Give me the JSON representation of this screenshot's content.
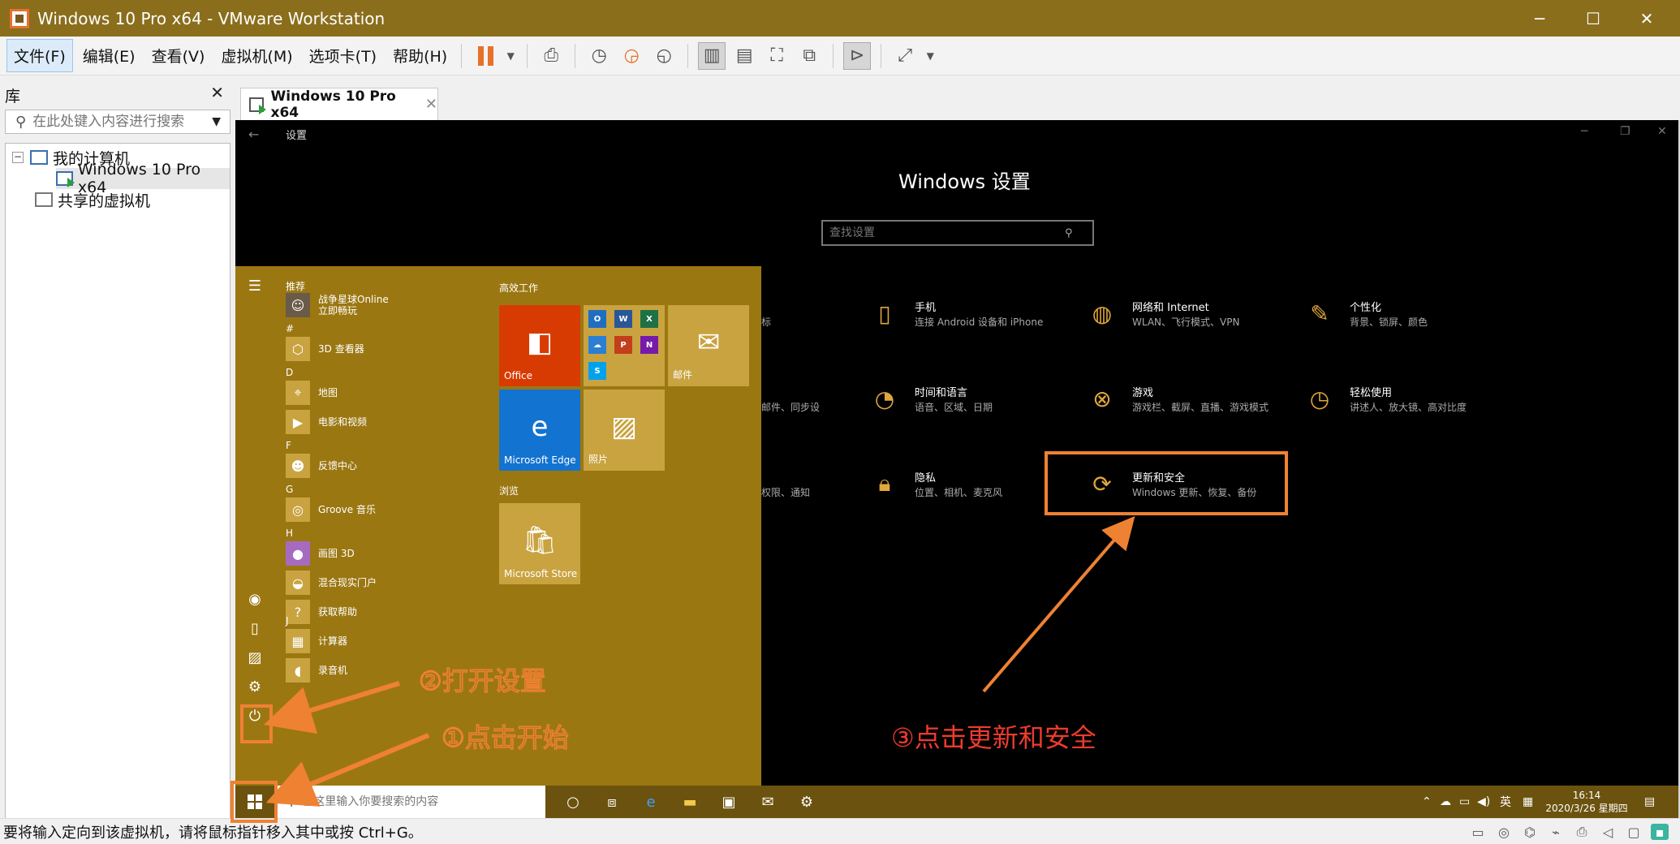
{
  "window": {
    "title": "Windows 10 Pro x64 - VMware Workstation",
    "controls": [
      "─",
      "☐",
      "✕"
    ]
  },
  "menu": [
    "文件(F)",
    "编辑(E)",
    "查看(V)",
    "虚拟机(M)",
    "选项卡(T)",
    "帮助(H)"
  ],
  "library": {
    "title": "库",
    "search_placeholder": "在此处键入内容进行搜索",
    "tree": {
      "my_computer": "我的计算机",
      "vm": "Windows 10 Pro x64",
      "shared": "共享的虚拟机"
    }
  },
  "vm_tab": {
    "label": "Windows 10 Pro x64"
  },
  "settings": {
    "window_title": "设置",
    "heading": "Windows 设置",
    "search_placeholder": "查找设置",
    "items": [
      {
        "name": "手机",
        "desc": "连接 Android 设备和 iPhone",
        "icon": "phone-icon"
      },
      {
        "name": "网络和 Internet",
        "desc": "WLAN、飞行模式、VPN",
        "icon": "globe-icon"
      },
      {
        "name": "个性化",
        "desc": "背景、锁屏、颜色",
        "icon": "personalize-icon"
      },
      {
        "name": "时间和语言",
        "desc": "语音、区域、日期",
        "icon": "time-language-icon"
      },
      {
        "name": "游戏",
        "desc": "游戏栏、截屏、直播、游戏模式",
        "icon": "xbox-icon"
      },
      {
        "name": "轻松使用",
        "desc": "讲述人、放大镜、高对比度",
        "icon": "ease-of-access-icon"
      },
      {
        "name": "隐私",
        "desc": "位置、相机、麦克风",
        "icon": "lock-icon"
      },
      {
        "name": "更新和安全",
        "desc": "Windows 更新、恢复、备份",
        "icon": "update-icon"
      }
    ],
    "fragments": [
      "标",
      "邮件、同步设",
      "权限、通知"
    ]
  },
  "start_menu": {
    "sections": {
      "recommended": "推荐",
      "hash": "#",
      "d": "D",
      "f": "F",
      "g": "G",
      "h": "H",
      "j": "J"
    },
    "apps": {
      "game_line1": "战争星球Online",
      "game_line2": "立即畅玩",
      "viewer3d": "3D 查看器",
      "maps": "地图",
      "movies": "电影和视频",
      "feedback": "反馈中心",
      "groove": "Groove 音乐",
      "paint3d": "画图 3D",
      "mixed_reality": "混合现实门户",
      "get_help": "获取帮助",
      "calculator": "计算器",
      "recorder": "录音机"
    },
    "tile_groups": {
      "productivity": "高效工作",
      "browse": "浏览"
    },
    "tiles": {
      "office": "Office",
      "mail": "邮件",
      "edge": "Microsoft Edge",
      "photos": "照片",
      "store": "Microsoft Store"
    }
  },
  "taskbar": {
    "search_placeholder": "在这里输入你要搜索的内容",
    "ime": "英",
    "time": "16:14",
    "date": "2020/3/26 星期四"
  },
  "status_bar": {
    "text": "要将输入定向到该虚拟机，请将鼠标指针移入其中或按 Ctrl+G。"
  },
  "annotations": {
    "step1": "①点击开始",
    "step2": "②打开设置",
    "step3": "③点击更新和安全"
  },
  "colors": {
    "title_bar": "#8a6e1c",
    "start_menu": "#9b7712",
    "taskbar": "#6b520e",
    "accent": "#e0a73a",
    "annotation_orange": "#ef8133",
    "annotation_red": "#ef3b2c"
  }
}
